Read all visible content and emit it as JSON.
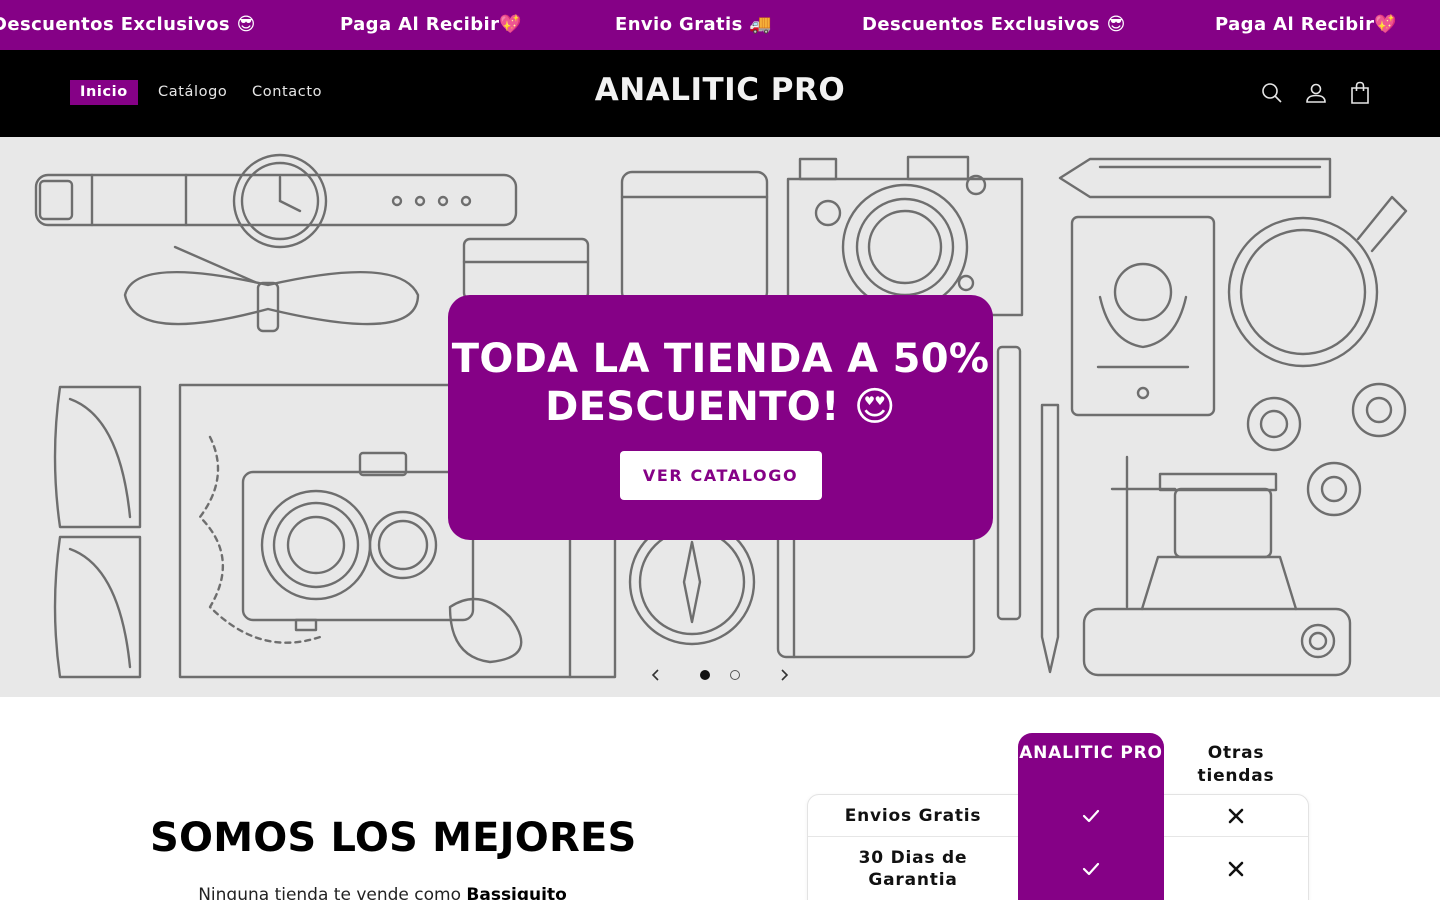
{
  "announcement": {
    "messages": [
      "Descuentos Exclusivos 😎",
      "Paga Al Recibir💖",
      "Envio Gratis 🚚",
      "Descuentos Exclusivos 😎",
      "Paga Al Recibir💖"
    ]
  },
  "header": {
    "nav": [
      "Inicio",
      "Catálogo",
      "Contacto"
    ],
    "logo": "ANALITIC PRO",
    "icons": [
      "search-icon",
      "account-icon",
      "cart-icon"
    ]
  },
  "hero": {
    "heading": "TODA LA TIENDA A 50% DESCUENTO! 😍",
    "button": "VER CATALOGO",
    "slide_count": 2,
    "active_slide": 1
  },
  "about": {
    "title": "SOMOS LOS MEJORES",
    "text_before": "Ninguna tienda te vende como ",
    "text_brand": "Bassiquito"
  },
  "comparison": {
    "brand_column": "ANALITIC PRO",
    "other_column": "Otras tiendas",
    "rows": [
      {
        "feature": "Envios Gratis",
        "brand": "check",
        "other": "cross"
      },
      {
        "feature": "30 Dias de Garantia",
        "brand": "check",
        "other": "cross"
      }
    ]
  },
  "colors": {
    "accent": "#850186",
    "header_bg": "#000000",
    "hero_bg": "#e8e8e8"
  }
}
